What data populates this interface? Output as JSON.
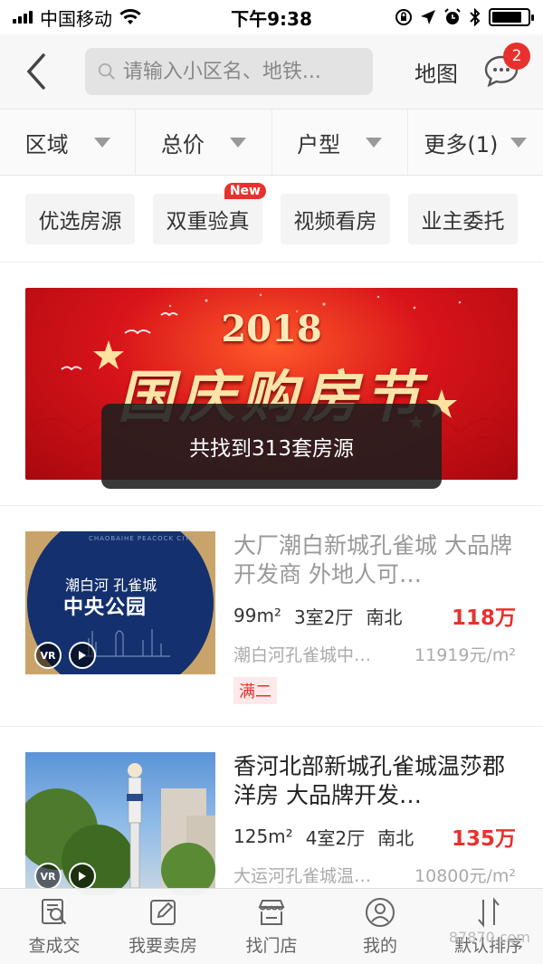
{
  "status_bar": {
    "carrier": "中国移动",
    "time": "下午9:38",
    "battery_level": 0.85
  },
  "nav": {
    "search_placeholder": "请输入小区名、地铁...",
    "map_label": "地图",
    "message_badge": "2"
  },
  "filters": [
    {
      "label": "区域"
    },
    {
      "label": "总价"
    },
    {
      "label": "户型"
    },
    {
      "label": "更多(1)"
    }
  ],
  "tags": [
    {
      "label": "优选房源",
      "new": ""
    },
    {
      "label": "双重验真",
      "new": "New"
    },
    {
      "label": "视频看房",
      "new": ""
    },
    {
      "label": "业主委托",
      "new": ""
    }
  ],
  "banner": {
    "year": "2018",
    "title": "国庆购房节"
  },
  "toast": "共找到313套房源",
  "listings": [
    {
      "title": "大厂潮白新城孔雀城 大品牌开发商 外地人可…",
      "area": "99m²",
      "layout": "3室2厅",
      "orientation": "南北",
      "price": "118万",
      "community": "潮白河孔雀城中…",
      "unit_price": "11919元/m²",
      "tag": "满二",
      "thumb": {
        "line0": "CHAOBAIHE PEACOCK CITY",
        "line1": "潮白河 孔雀城",
        "line2": "中央公园",
        "vr": "VR"
      }
    },
    {
      "title": "香河北部新城孔雀城温莎郡洋房 大品牌开发…",
      "area": "125m²",
      "layout": "4室2厅",
      "orientation": "南北",
      "price": "135万",
      "community": "大运河孔雀城温…",
      "unit_price": "10800元/m²",
      "thumb": {
        "vr": "VR"
      }
    }
  ],
  "tabs": [
    {
      "label": "查成交",
      "icon": "search-deal-icon"
    },
    {
      "label": "我要卖房",
      "icon": "edit-icon"
    },
    {
      "label": "找门店",
      "icon": "store-icon"
    },
    {
      "label": "我的",
      "icon": "user-icon"
    },
    {
      "label": "默认排序",
      "icon": "sort-icon"
    }
  ],
  "watermark": "87870.com",
  "colors": {
    "accent": "#e8312e",
    "banner": "#d8141a"
  }
}
